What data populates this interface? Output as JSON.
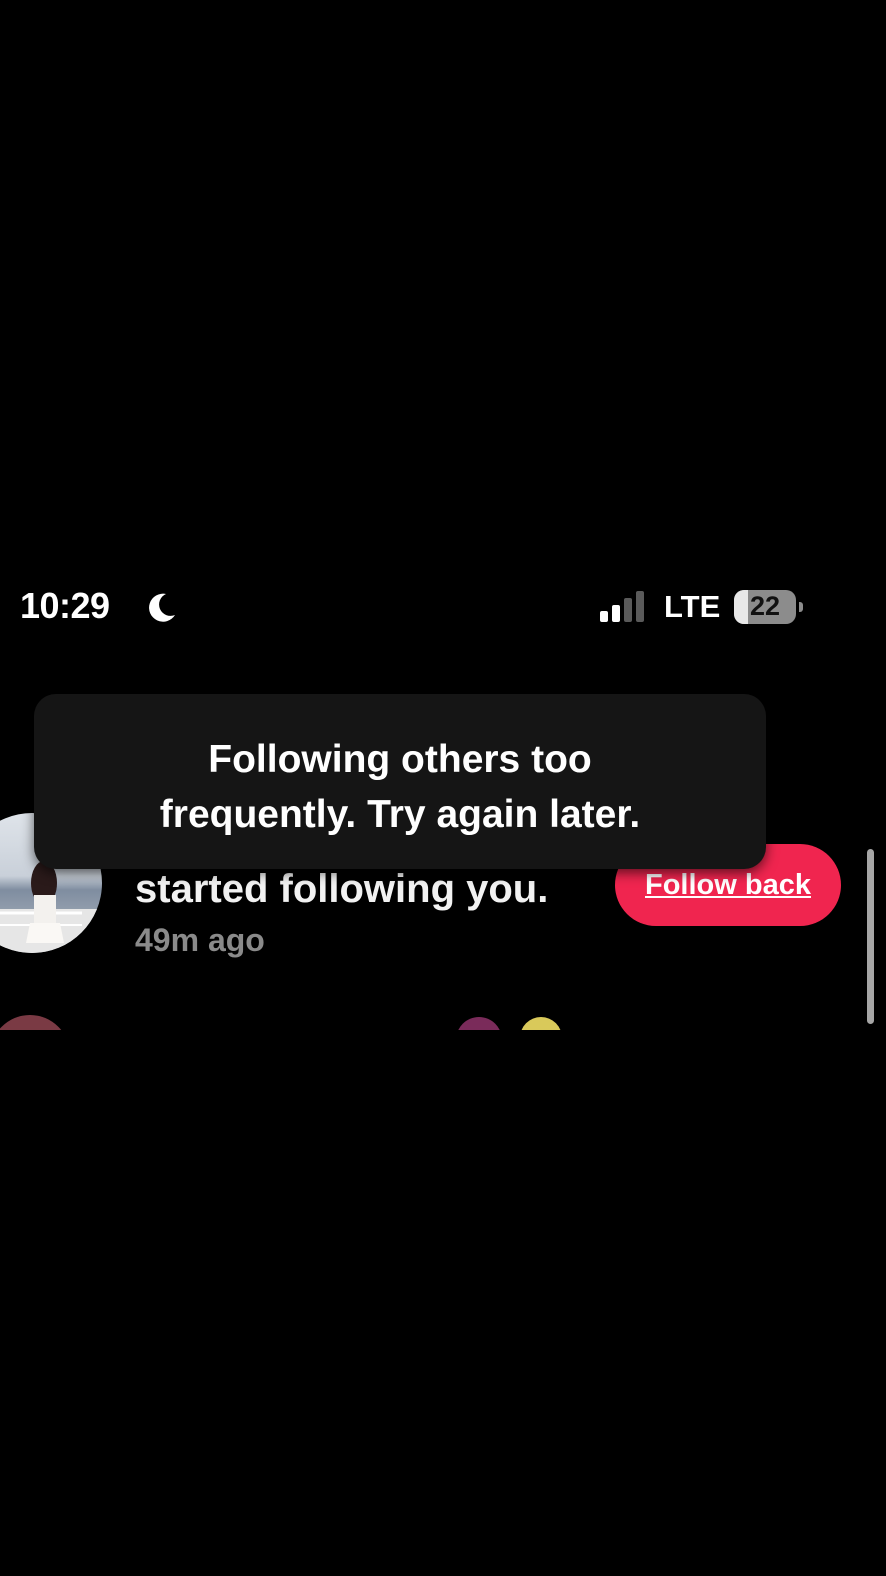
{
  "status_bar": {
    "time": "10:29",
    "moon_icon": "moon-icon",
    "signal_icon": "cellular-signal-icon",
    "network": "LTE",
    "battery_level": "22",
    "battery_fraction": 0.22
  },
  "notification": {
    "action_text": "started following you.",
    "time_ago": "49m ago",
    "follow_back_label": "Follow back",
    "button_color": "#f0254f"
  },
  "toast": {
    "message_line1": "Following others too",
    "message_line2": "frequently. Try again later."
  }
}
